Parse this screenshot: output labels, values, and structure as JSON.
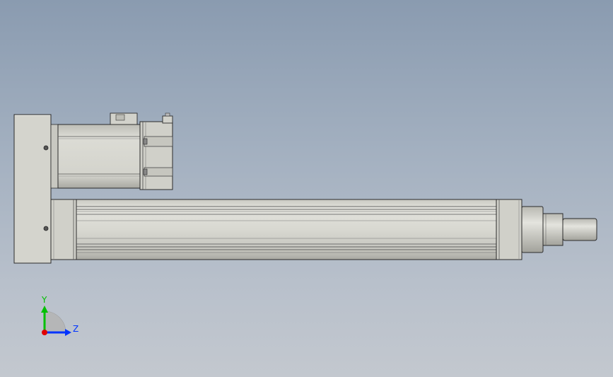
{
  "scene": {
    "background_top": "#8a9bb0",
    "background_bottom": "#c3c8cf",
    "part_fill": "#d6d6cf",
    "part_shade": "#b9b9b2",
    "part_dark": "#9a9a94",
    "outline": "#2b2b2b"
  },
  "triad": {
    "y_label": "Y",
    "z_label": "Z",
    "y_color": "#00c000",
    "z_color": "#0033ff",
    "x_color": "#e00000"
  }
}
